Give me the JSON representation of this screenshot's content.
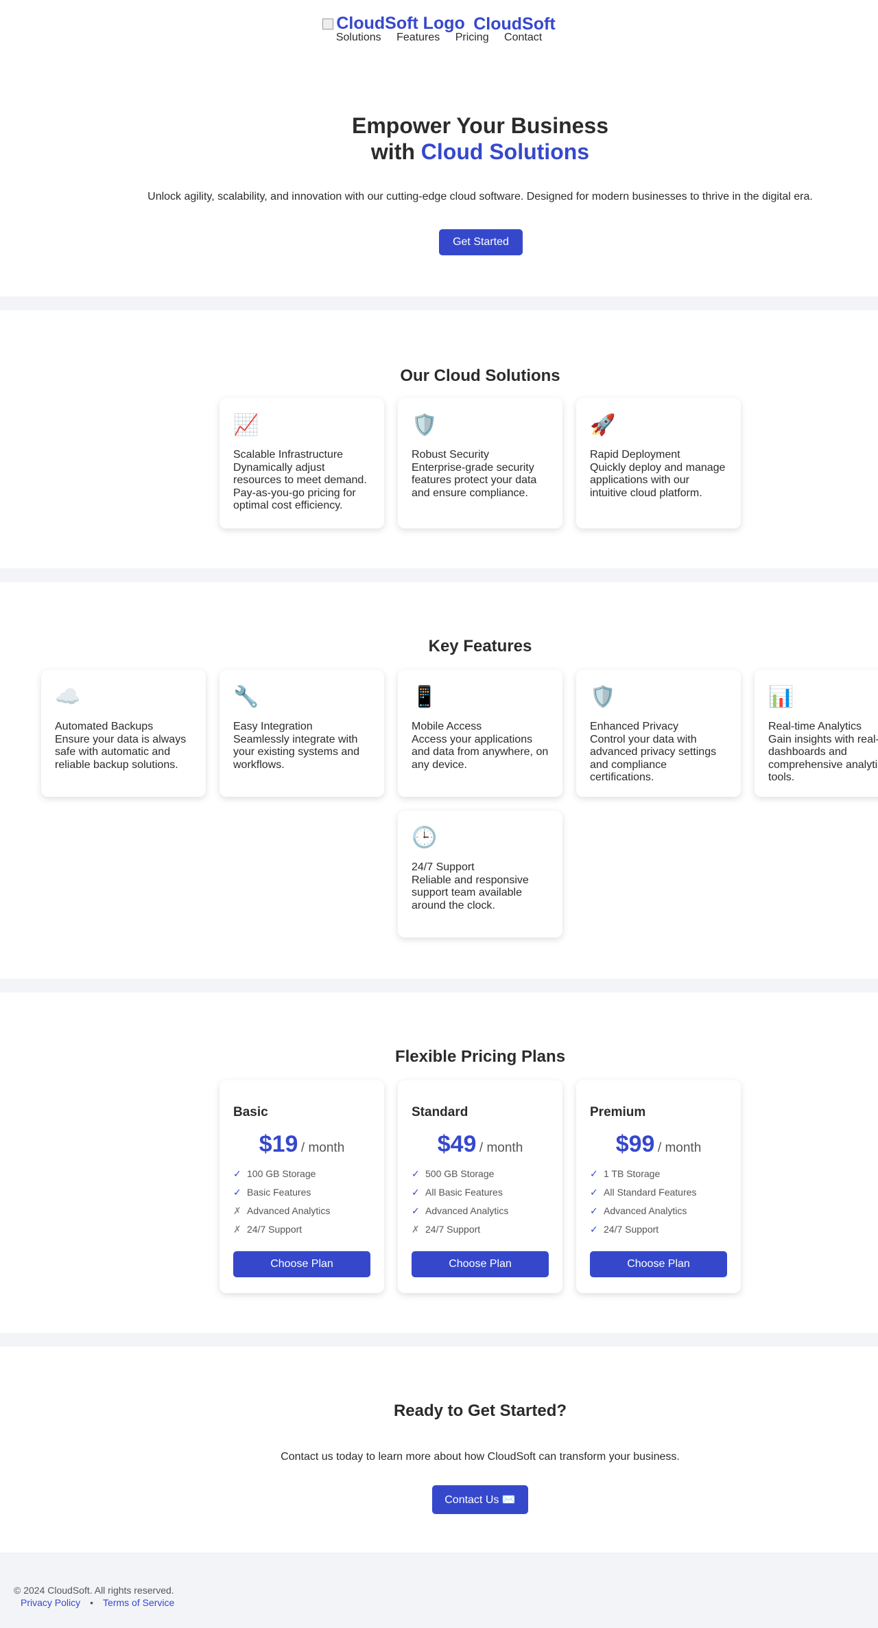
{
  "header": {
    "logo_alt": "CloudSoft Logo",
    "brand_name": "CloudSoft",
    "nav": [
      "Solutions",
      "Features",
      "Pricing",
      "Contact"
    ]
  },
  "hero": {
    "title_line1": "Empower Your Business",
    "title_line2_prefix": "with ",
    "title_line2_accent": "Cloud Solutions",
    "subtitle": "Unlock agility, scalability, and innovation with our cutting-edge cloud software. Designed for modern businesses to thrive in the digital era.",
    "cta_label": "Get Started"
  },
  "solutions": {
    "title": "Our Cloud Solutions",
    "items": [
      {
        "icon": "📈",
        "icon_name": "chart-up-icon",
        "title": "Scalable Infrastructure",
        "desc": "Dynamically adjust resources to meet demand. Pay-as-you-go pricing for optimal cost efficiency."
      },
      {
        "icon": "🛡️",
        "icon_name": "shield-icon",
        "title": "Robust Security",
        "desc": "Enterprise-grade security features protect your data and ensure compliance."
      },
      {
        "icon": "🚀",
        "icon_name": "rocket-icon",
        "title": "Rapid Deployment",
        "desc": "Quickly deploy and manage applications with our intuitive cloud platform."
      }
    ]
  },
  "features": {
    "title": "Key Features",
    "items": [
      {
        "icon": "☁️",
        "icon_name": "cloud-icon",
        "title": "Automated Backups",
        "desc": "Ensure your data is always safe with automatic and reliable backup solutions."
      },
      {
        "icon": "🔧",
        "icon_name": "wrench-icon",
        "title": "Easy Integration",
        "desc": "Seamlessly integrate with your existing systems and workflows."
      },
      {
        "icon": "📱",
        "icon_name": "mobile-phone-icon",
        "title": "Mobile Access",
        "desc": "Access your applications and data from anywhere, on any device."
      },
      {
        "icon": "🛡️",
        "icon_name": "shield-icon",
        "title": "Enhanced Privacy",
        "desc": "Control your data with advanced privacy settings and compliance certifications."
      },
      {
        "icon": "📊",
        "icon_name": "bar-chart-icon",
        "title": "Real-time Analytics",
        "desc": "Gain insights with real-time dashboards and comprehensive analytics tools."
      },
      {
        "icon": "🕒",
        "icon_name": "clock-icon",
        "title": "24/7 Support",
        "desc": "Reliable and responsive support team available around the clock."
      }
    ]
  },
  "pricing": {
    "title": "Flexible Pricing Plans",
    "per": "/ month",
    "choose_label": "Choose Plan",
    "check_mark": "✓",
    "cross_mark": "✗",
    "plans": [
      {
        "name": "Basic",
        "price": "$19",
        "features": [
          {
            "text": "100 GB Storage",
            "included": true
          },
          {
            "text": "Basic Features",
            "included": true
          },
          {
            "text": "Advanced Analytics",
            "included": false
          },
          {
            "text": "24/7 Support",
            "included": false
          }
        ]
      },
      {
        "name": "Standard",
        "price": "$49",
        "features": [
          {
            "text": "500 GB Storage",
            "included": true
          },
          {
            "text": "All Basic Features",
            "included": true
          },
          {
            "text": "Advanced Analytics",
            "included": true
          },
          {
            "text": "24/7 Support",
            "included": false
          }
        ]
      },
      {
        "name": "Premium",
        "price": "$99",
        "features": [
          {
            "text": "1 TB Storage",
            "included": true
          },
          {
            "text": "All Standard Features",
            "included": true
          },
          {
            "text": "Advanced Analytics",
            "included": true
          },
          {
            "text": "24/7 Support",
            "included": true
          }
        ]
      }
    ]
  },
  "cta": {
    "title": "Ready to Get Started?",
    "text": "Contact us today to learn more about how CloudSoft can transform your business.",
    "button_label": "Contact Us ✉️"
  },
  "footer": {
    "copyright": "© 2024 CloudSoft. All rights reserved.",
    "privacy": "Privacy Policy",
    "separator": "•",
    "terms": "Terms of Service"
  },
  "colors": {
    "accent": "#3548cc",
    "page_bg": "#f3f4f8",
    "text": "#2b2b2b"
  }
}
